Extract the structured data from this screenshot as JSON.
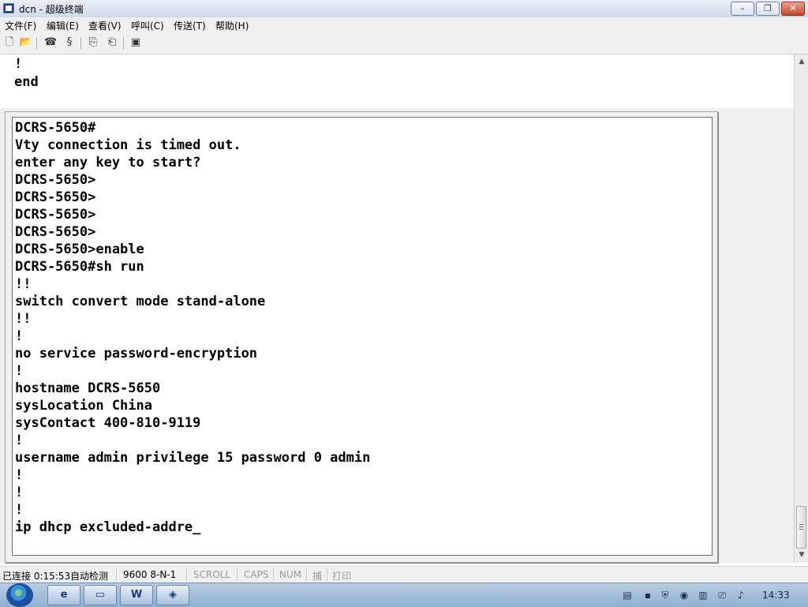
{
  "window": {
    "title": "dcn - 超级终端",
    "buttons": {
      "minimize": "–",
      "maximize": "❐",
      "close": "✕"
    }
  },
  "menu": [
    {
      "label": "文件(F)"
    },
    {
      "label": "编辑(E)"
    },
    {
      "label": "查看(V)"
    },
    {
      "label": "呼叫(C)"
    },
    {
      "label": "传送(T)"
    },
    {
      "label": "帮助(H)"
    }
  ],
  "toolbar": {
    "icons": [
      "new-icon",
      "open-icon",
      "disconnect-icon",
      "call-icon",
      "send-icon",
      "receive-icon",
      "properties-icon"
    ]
  },
  "top_pane": {
    "lines": [
      "!",
      "end"
    ]
  },
  "terminal": {
    "lines": [
      "DCRS-5650#",
      "Vty connection is timed out.",
      "enter any key to start?",
      "DCRS-5650>",
      "DCRS-5650>",
      "DCRS-5650>",
      "DCRS-5650>",
      "DCRS-5650>enable",
      "DCRS-5650#sh run",
      "!!",
      "switch convert mode stand-alone",
      "!!",
      "!",
      "no service password-encryption",
      "!",
      "hostname DCRS-5650",
      "sysLocation China",
      "sysContact 400-810-9119",
      "!",
      "username admin privilege 15 password 0 admin",
      "!",
      "!",
      "!",
      "ip dhcp excluded-addre_"
    ]
  },
  "status": {
    "connected": "已连接 0:15:53",
    "detect": "自动检测",
    "baud": "9600 8-N-1",
    "scroll": "SCROLL",
    "caps": "CAPS",
    "num": "NUM",
    "capture": "捕",
    "print": "打印"
  },
  "taskbar": {
    "apps": [
      "ie-icon",
      "explorer-icon",
      "word-icon",
      "hyperterminal-icon"
    ],
    "clock": "14:33"
  }
}
